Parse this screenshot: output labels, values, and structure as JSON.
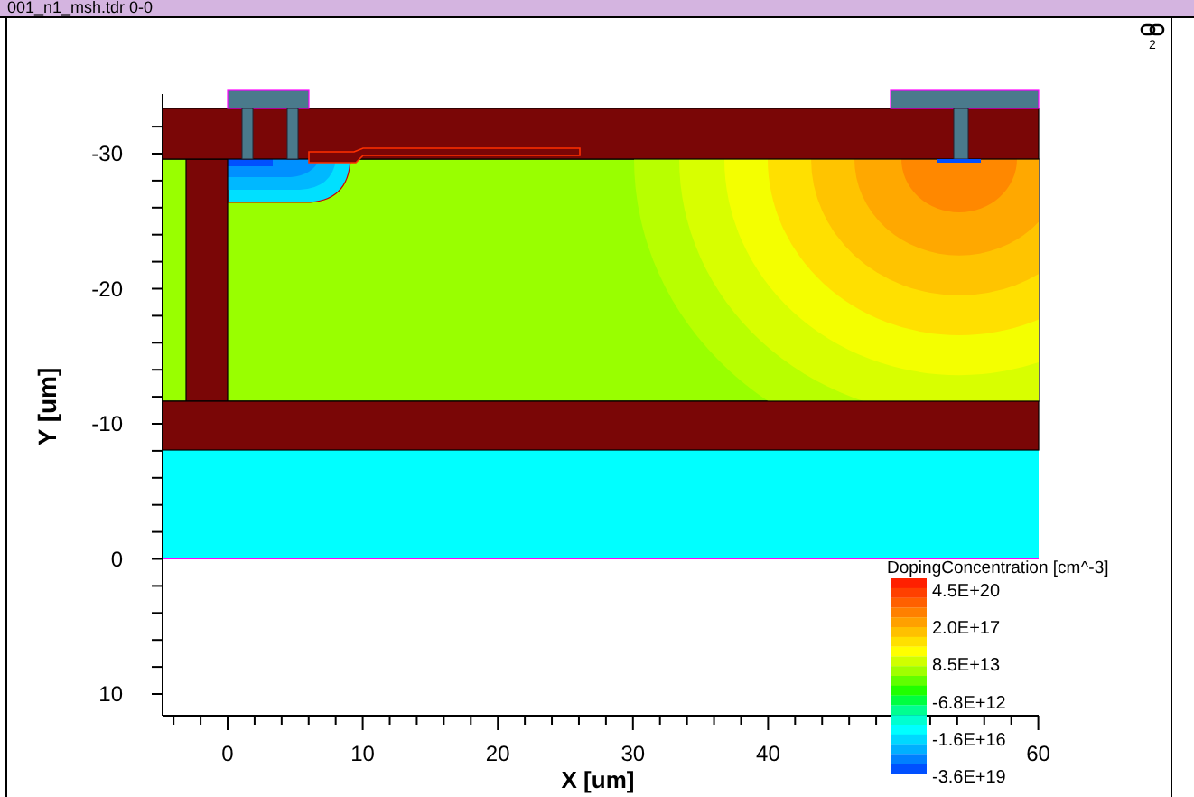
{
  "window": {
    "title": "001_n1_msh.tdr 0-0"
  },
  "link_badge": {
    "count": "2"
  },
  "plot": {
    "x_axis": {
      "label": "X [um]",
      "tick_labels": [
        "0",
        "10",
        "20",
        "30",
        "40",
        "60"
      ]
    },
    "y_axis": {
      "label": "Y [um]",
      "tick_labels": [
        "-30",
        "-20",
        "-10",
        "0",
        "10"
      ]
    },
    "legend": {
      "title": "DopingConcentration [cm^-3]",
      "labels": [
        "4.5E+20",
        "2.0E+17",
        "8.5E+13",
        "-6.8E+12",
        "-1.6E+16",
        "-3.6E+19"
      ]
    }
  }
}
